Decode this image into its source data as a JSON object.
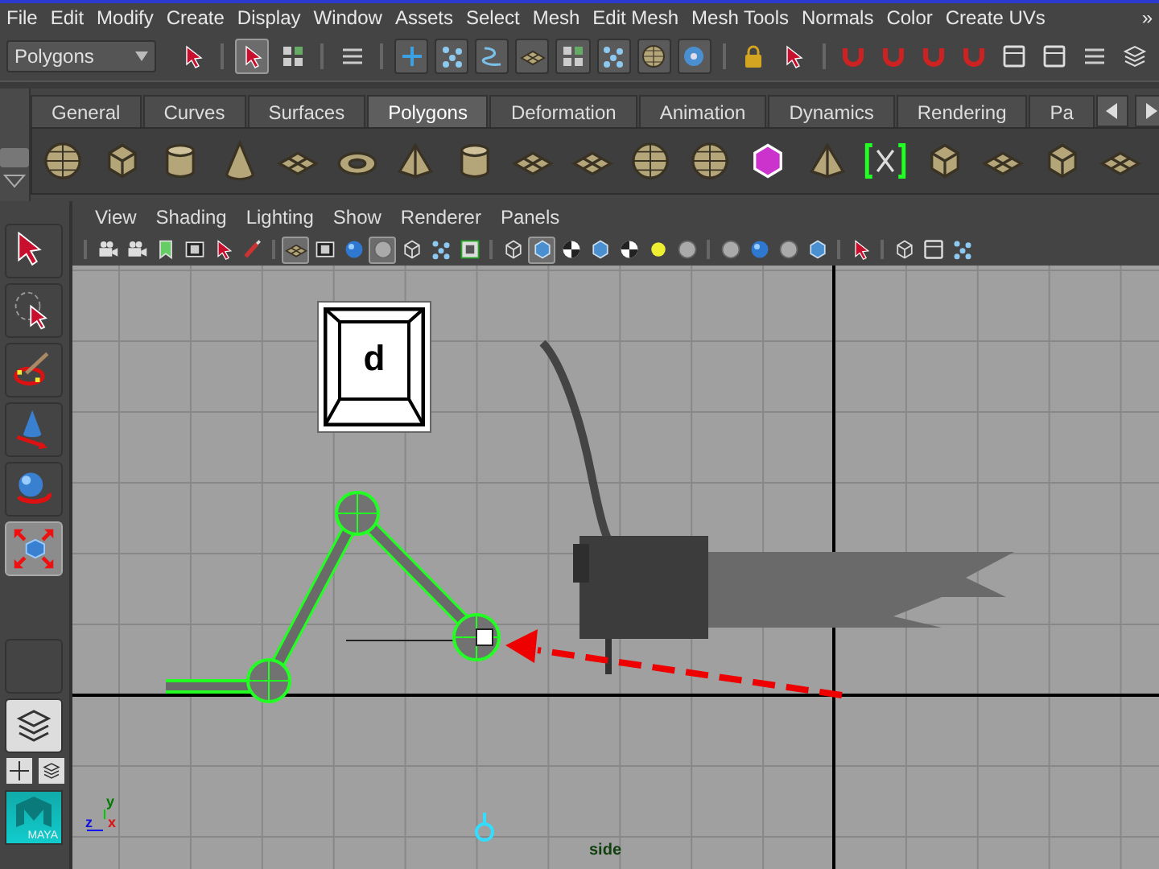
{
  "menu_bar": {
    "items": [
      "File",
      "Edit",
      "Modify",
      "Create",
      "Display",
      "Window",
      "Assets",
      "Select",
      "Mesh",
      "Edit Mesh",
      "Mesh Tools",
      "Normals",
      "Color",
      "Create UVs"
    ],
    "overflow": "»"
  },
  "status_line": {
    "mode": "Polygons",
    "buttons": [
      {
        "selected": false
      },
      {
        "selected": true
      },
      {
        "selected": false
      },
      {
        "selected": false
      },
      {
        "selected": false
      },
      {
        "selected": false
      },
      {
        "selected": false
      },
      {
        "selected": false
      },
      {
        "selected": false
      },
      {
        "selected": false
      },
      {
        "selected": false
      },
      {
        "selected": false
      },
      {
        "selected": false
      },
      {
        "selected": false
      },
      {
        "selected": false
      },
      {
        "selected": false
      },
      {
        "selected": false
      },
      {
        "selected": false
      },
      {
        "selected": false
      },
      {
        "selected": false
      },
      {
        "selected": false
      },
      {
        "selected": false
      }
    ]
  },
  "shelf": {
    "tabs": [
      {
        "label": "General",
        "selected": false
      },
      {
        "label": "Curves",
        "selected": false
      },
      {
        "label": "Surfaces",
        "selected": false
      },
      {
        "label": "Polygons",
        "selected": true
      },
      {
        "label": "Deformation",
        "selected": false
      },
      {
        "label": "Animation",
        "selected": false
      },
      {
        "label": "Dynamics",
        "selected": false
      },
      {
        "label": "Rendering",
        "selected": false
      },
      {
        "label": "Pa",
        "selected": false
      }
    ]
  },
  "toolbox": {
    "tools": [
      {
        "selected": false
      },
      {
        "selected": false
      },
      {
        "selected": false
      },
      {
        "selected": false
      },
      {
        "selected": false
      },
      {
        "selected": true
      }
    ],
    "logo_text": "MAYA"
  },
  "panel": {
    "menu": [
      "View",
      "Shading",
      "Lighting",
      "Show",
      "Renderer",
      "Panels"
    ],
    "toolbar": [
      {
        "selected": false
      },
      {
        "selected": false
      },
      {
        "selected": false
      },
      {
        "selected": false
      },
      {
        "selected": false
      },
      {
        "selected": false
      },
      {
        "selected": true
      },
      {
        "selected": false
      },
      {
        "selected": false
      },
      {
        "selected": true
      },
      {
        "selected": false
      },
      {
        "selected": false
      },
      {
        "selected": false
      },
      {
        "selected": false
      },
      {
        "selected": true
      },
      {
        "selected": false
      },
      {
        "selected": false
      },
      {
        "selected": false
      },
      {
        "selected": false
      },
      {
        "selected": false
      },
      {
        "selected": false
      },
      {
        "selected": false
      },
      {
        "selected": false
      },
      {
        "selected": false
      },
      {
        "selected": false
      },
      {
        "selected": false
      },
      {
        "selected": false
      },
      {
        "selected": false
      }
    ]
  },
  "viewport": {
    "key_label": "d",
    "axis_labels": [
      {
        "text": "y",
        "color": "#007a00"
      },
      {
        "text": "z",
        "color": "#1010e0"
      },
      {
        "text": "x",
        "color": "#e01010"
      }
    ],
    "camera_label": "side"
  }
}
